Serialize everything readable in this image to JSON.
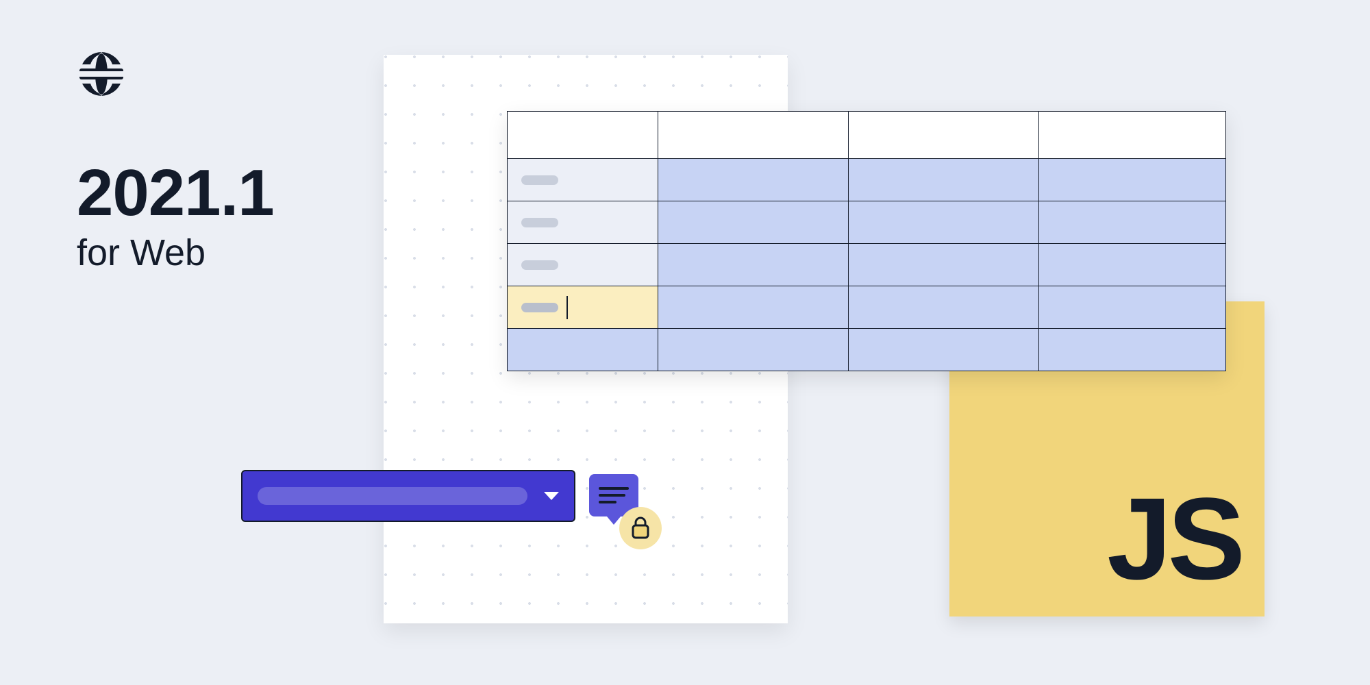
{
  "globe_icon": "globe-icon",
  "headline": {
    "version": "2021.1",
    "subtitle": "for Web"
  },
  "js_note": {
    "label": "JS"
  },
  "dropdown": {
    "caret_icon": "chevron-down-icon"
  },
  "comment": {
    "icon": "text-lines-icon",
    "lock_icon": "lock-icon"
  },
  "sheet": {
    "columns": 4,
    "rows": 5,
    "active_row_index": 3
  }
}
